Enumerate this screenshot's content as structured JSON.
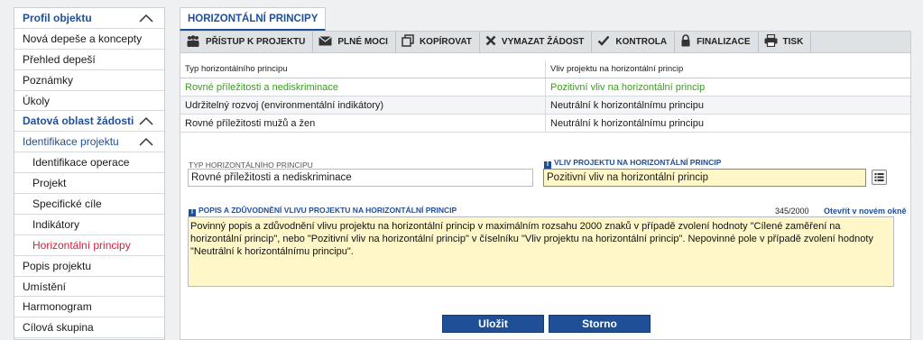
{
  "sidebar": {
    "items": [
      {
        "label": "Profil objektu"
      },
      {
        "label": "Nová depeše a koncepty"
      },
      {
        "label": "Přehled depeší"
      },
      {
        "label": "Poznámky"
      },
      {
        "label": "Úkoly"
      },
      {
        "label": "Datová oblast žádosti"
      },
      {
        "label": "Identifikace projektu"
      },
      {
        "label": "Identifikace operace"
      },
      {
        "label": "Projekt"
      },
      {
        "label": "Specifické cíle"
      },
      {
        "label": "Indikátory"
      },
      {
        "label": "Horizontální principy"
      },
      {
        "label": "Popis projektu"
      },
      {
        "label": "Umístění"
      },
      {
        "label": "Harmonogram"
      },
      {
        "label": "Cílová skupina"
      }
    ]
  },
  "tab": {
    "label": "HORIZONTÁLNÍ PRINCIPY"
  },
  "toolbar": {
    "access": "PŘÍSTUP K PROJEKTU",
    "power": "PLNÉ MOCI",
    "copy": "KOPÍROVAT",
    "delete": "VYMAZAT ŽÁDOST",
    "check": "KONTROLA",
    "finalize": "FINALIZACE",
    "print": "TISK"
  },
  "table": {
    "headers": [
      "Typ horizontálního principu",
      "Vliv projektu na horizontální princip"
    ],
    "rows": [
      {
        "type": "Rovné příležitosti a nediskriminace",
        "impact": "Pozitivní vliv na horizontální princip"
      },
      {
        "type": "Udržitelný rozvoj (environmentální indikátory)",
        "impact": "Neutrální k horizontálnímu principu"
      },
      {
        "type": "Rovné příležitosti mužů a žen",
        "impact": "Neutrální k horizontálnímu principu"
      }
    ]
  },
  "form": {
    "type_label": "TYP HORIZONTÁLNÍHO PRINCIPU",
    "type_value": "Rovné příležitosti a nediskriminace",
    "impact_label": "VLIV PROJEKTU NA HORIZONTÁLNÍ PRINCIP",
    "impact_value": "Pozitivní vliv na horizontální princip",
    "desc_label": "POPIS A ZDŮVODNĚNÍ VLIVU PROJEKTU NA HORIZONTÁLNÍ PRINCIP",
    "counter": "345/2000",
    "open_new": "Otevřít v novém okně",
    "desc_value": "Povinný popis a zdůvodnění vlivu projektu na horizontální princip v maximálním rozsahu 2000 znaků v případě zvolení hodnoty \"Cílené zaměření na horizontální princip\", nebo \"Pozitivní vliv na horizontální princip\" v číselníku \"Vliv projektu na horizontální princip\". Nepovinné pole v případě zvolení hodnoty \"Neutrální k horizontálnímu principu\"."
  },
  "actions": {
    "save": "Uložit",
    "cancel": "Storno"
  },
  "colors": {
    "brand": "#1f4f96",
    "active": "#d0223d",
    "positive": "#3c9b21",
    "field_highlight": "#fff7c7"
  }
}
